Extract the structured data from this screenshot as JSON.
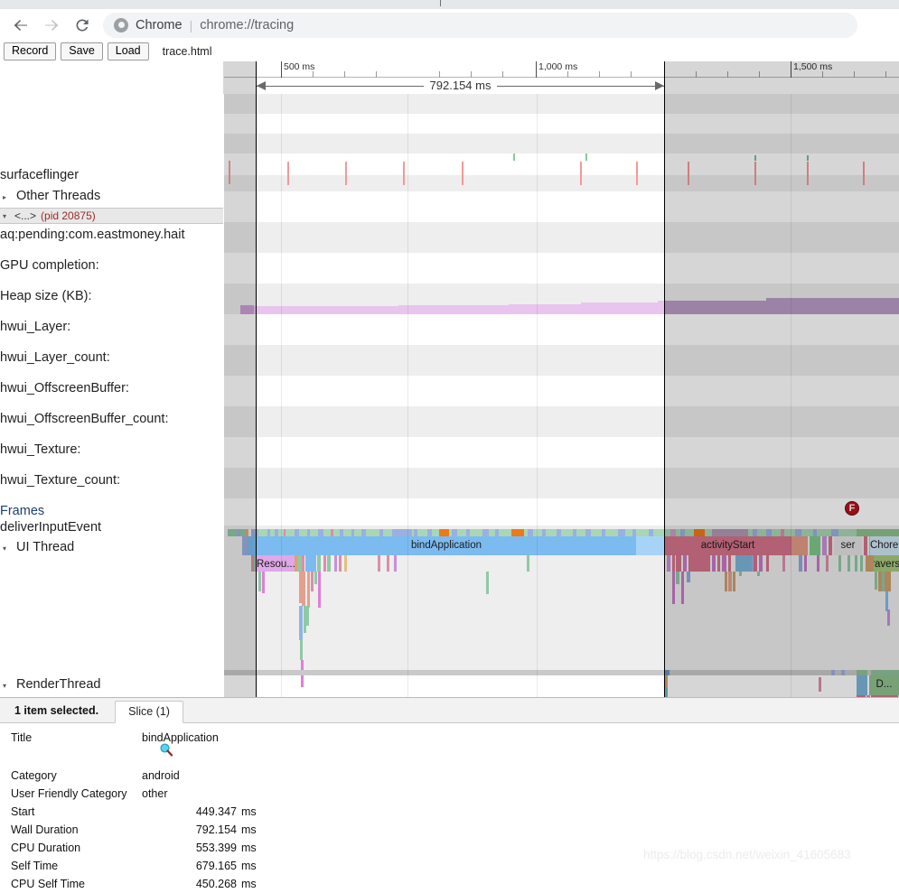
{
  "browser": {
    "back_icon": "back-arrow-icon",
    "forward_icon": "forward-arrow-icon",
    "reload_icon": "reload-icon",
    "app_name": "Chrome",
    "separator": "|",
    "url": "chrome://tracing"
  },
  "tracing_toolbar": {
    "record_label": "Record",
    "save_label": "Save",
    "load_label": "Load",
    "filename": "trace.html"
  },
  "timeline": {
    "ruler_labels": [
      "500 ms",
      "1,000 ms",
      "1,500 ms"
    ],
    "selection_duration": "792.154 ms",
    "flow_marker": "F"
  },
  "tracks": [
    {
      "label": "surfaceflinger",
      "indent": 0,
      "caret": ""
    },
    {
      "label": "Other Threads",
      "indent": 1,
      "caret": "▸"
    },
    {
      "label": "aq:pending:com.eastmoney.hait",
      "indent": 0,
      "caret": ""
    },
    {
      "label": "GPU completion:",
      "indent": 0,
      "caret": ""
    },
    {
      "label": "Heap size (KB):",
      "indent": 0,
      "caret": ""
    },
    {
      "label": "hwui_Layer:",
      "indent": 0,
      "caret": ""
    },
    {
      "label": "hwui_Layer_count:",
      "indent": 0,
      "caret": ""
    },
    {
      "label": "hwui_OffscreenBuffer:",
      "indent": 0,
      "caret": ""
    },
    {
      "label": "hwui_OffscreenBuffer_count:",
      "indent": 0,
      "caret": ""
    },
    {
      "label": "hwui_Texture:",
      "indent": 0,
      "caret": ""
    },
    {
      "label": "hwui_Texture_count:",
      "indent": 0,
      "caret": ""
    },
    {
      "label": "Frames",
      "indent": 0,
      "caret": ""
    },
    {
      "label": "deliverInputEvent",
      "indent": 0,
      "caret": ""
    },
    {
      "label": "UI Thread",
      "indent": 1,
      "caret": "▾"
    },
    {
      "label": "RenderThread",
      "indent": 1,
      "caret": "▾"
    }
  ],
  "process_group": {
    "caret": "▾",
    "name": "<...>",
    "pid": "(pid 20875)"
  },
  "slices": {
    "bind_application": "bindApplication",
    "resources": "Resou...",
    "activity_start": "activityStart",
    "ser": "ser",
    "choreographer": "Chore...",
    "traversal": "traversal",
    "draw_frame": "D..."
  },
  "analysis": {
    "selection_text": "1 item selected.",
    "tab_label": "Slice (1)",
    "magnifier_icon": "magnifier-icon",
    "rows": [
      {
        "key": "Title",
        "value": "bindApplication",
        "unit": "",
        "align": "left"
      },
      {
        "key": "Category",
        "value": "android",
        "unit": "",
        "align": "left"
      },
      {
        "key": "User Friendly Category",
        "value": "other",
        "unit": "",
        "align": "left"
      },
      {
        "key": "Start",
        "value": "449.347",
        "unit": "ms",
        "align": "right"
      },
      {
        "key": "Wall Duration",
        "value": "792.154",
        "unit": "ms",
        "align": "right"
      },
      {
        "key": "CPU Duration",
        "value": "553.399",
        "unit": "ms",
        "align": "right"
      },
      {
        "key": "Self Time",
        "value": "679.165",
        "unit": "ms",
        "align": "right"
      },
      {
        "key": "CPU Self Time",
        "value": "450.268",
        "unit": "ms",
        "align": "right"
      }
    ]
  },
  "watermark": "https://blog.csdn.net/weixin_41605683",
  "colors": {
    "accent_red": "#b5121b",
    "bind_application": "#7cbbf0",
    "activity_start": "#d4738a",
    "heap_fill": "#e3b6ea",
    "resources": "#dfa8e8",
    "traversal": "#a7c97e",
    "choreographer": "#8fc08f"
  }
}
